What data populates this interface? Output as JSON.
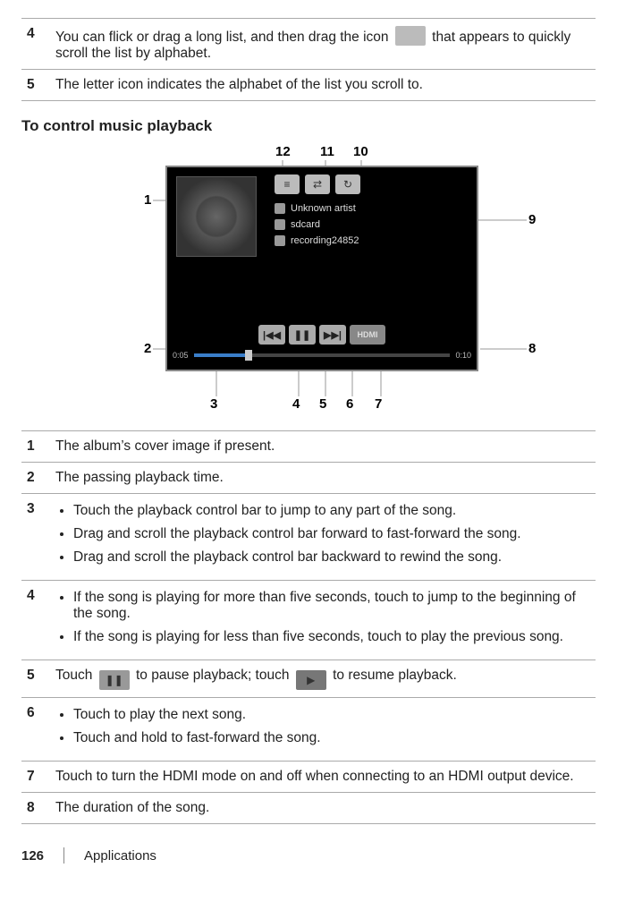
{
  "top_steps": [
    {
      "num": "4",
      "text_a": "You can flick or drag a long list, and then drag the icon",
      "text_b": "that appears to quickly scroll the list by alphabet."
    },
    {
      "num": "5",
      "text": "The letter icon indicates the alphabet of the list you scroll to."
    }
  ],
  "heading": "To control music playback",
  "player": {
    "track_artist": "Unknown artist",
    "track_album": "sdcard",
    "track_title": "recording24852",
    "time_elapsed": "0:05",
    "time_total": "0:10",
    "hdmi": "HDMI"
  },
  "callouts": {
    "c1": "1",
    "c2": "2",
    "c3": "3",
    "c4": "4",
    "c5": "5",
    "c6": "6",
    "c7": "7",
    "c8": "8",
    "c9": "9",
    "c10": "10",
    "c11": "11",
    "c12": "12"
  },
  "rows": [
    {
      "num": "1",
      "text": "The album’s cover image if present."
    },
    {
      "num": "2",
      "text": "The passing playback time."
    },
    {
      "num": "3",
      "bullets": [
        "Touch the playback control bar to jump to any part of the song.",
        "Drag and scroll the playback control bar forward to fast-forward the song.",
        "Drag and scroll the playback control bar backward to rewind the song."
      ]
    },
    {
      "num": "4",
      "bullets": [
        "If the song is playing for more than five seconds, touch to jump to the beginning of the song.",
        "If the song is playing for less than five seconds, touch to play the previous song."
      ]
    },
    {
      "num": "5",
      "text_a": "Touch",
      "text_b": "to pause playback; touch",
      "text_c": "to resume playback."
    },
    {
      "num": "6",
      "bullets": [
        "Touch to play the next song.",
        "Touch and hold to fast-forward the song."
      ]
    },
    {
      "num": "7",
      "text": "Touch to turn the HDMI mode on and off when connecting to an HDMI output device."
    },
    {
      "num": "8",
      "text": "The duration of the song."
    }
  ],
  "footer": {
    "page": "126",
    "section": "Applications"
  }
}
